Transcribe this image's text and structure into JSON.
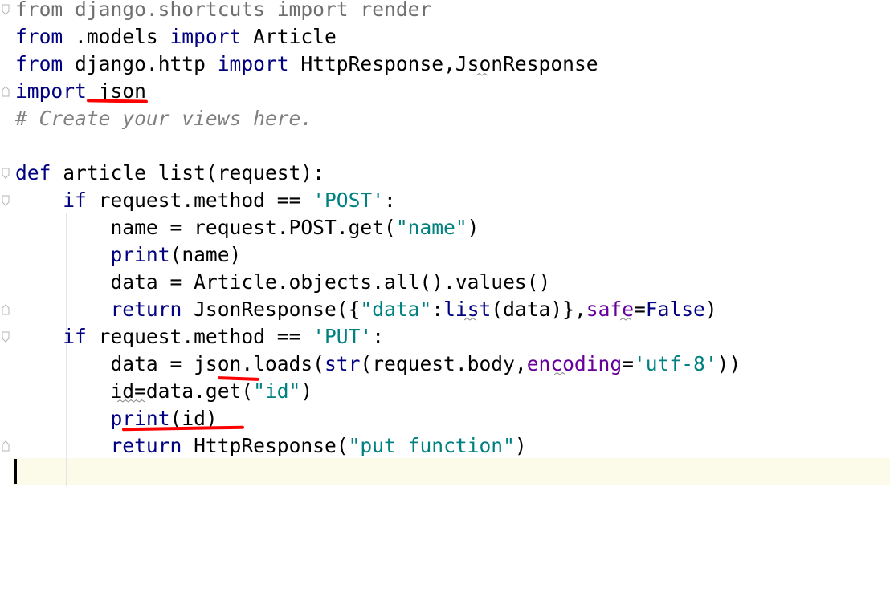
{
  "editor": {
    "language": "python",
    "colors": {
      "keyword": "#000080",
      "string": "#008080",
      "comment": "#808080",
      "param": "#660099",
      "current_line": "#fcfae8",
      "annotation_ink": "#ff0000"
    },
    "lines": [
      {
        "tokens": [
          {
            "t": "from django.shortcuts import render",
            "c": "dim"
          }
        ]
      },
      {
        "tokens": [
          {
            "t": "from",
            "c": "kw"
          },
          {
            "t": " .models ",
            "c": ""
          },
          {
            "t": "import",
            "c": "kw"
          },
          {
            "t": " Article",
            "c": ""
          }
        ]
      },
      {
        "tokens": [
          {
            "t": "from",
            "c": "kw"
          },
          {
            "t": " django.http ",
            "c": ""
          },
          {
            "t": "import",
            "c": "kw"
          },
          {
            "t": " HttpResponse,JsonResponse",
            "c": ""
          }
        ]
      },
      {
        "tokens": [
          {
            "t": "import",
            "c": "kw"
          },
          {
            "t": " json",
            "c": ""
          }
        ]
      },
      {
        "tokens": [
          {
            "t": "# Create your views here.",
            "c": "cm"
          }
        ]
      },
      {
        "tokens": [
          {
            "t": "",
            "c": ""
          }
        ]
      },
      {
        "tokens": [
          {
            "t": "def",
            "c": "kw"
          },
          {
            "t": " article_list(request):",
            "c": ""
          }
        ]
      },
      {
        "tokens": [
          {
            "t": "    ",
            "c": ""
          },
          {
            "t": "if",
            "c": "kw"
          },
          {
            "t": " request.method == ",
            "c": ""
          },
          {
            "t": "'POST'",
            "c": "str"
          },
          {
            "t": ":",
            "c": ""
          }
        ]
      },
      {
        "tokens": [
          {
            "t": "        name = request.POST.get(",
            "c": ""
          },
          {
            "t": "\"name\"",
            "c": "str"
          },
          {
            "t": ")",
            "c": ""
          }
        ]
      },
      {
        "tokens": [
          {
            "t": "        ",
            "c": ""
          },
          {
            "t": "print",
            "c": "bi"
          },
          {
            "t": "(name)",
            "c": ""
          }
        ]
      },
      {
        "tokens": [
          {
            "t": "        data = Article.objects.all().values()",
            "c": ""
          }
        ]
      },
      {
        "tokens": [
          {
            "t": "        ",
            "c": ""
          },
          {
            "t": "return",
            "c": "kw"
          },
          {
            "t": " JsonResponse({",
            "c": ""
          },
          {
            "t": "\"data\"",
            "c": "str"
          },
          {
            "t": ":",
            "c": ""
          },
          {
            "t": "list",
            "c": "bi"
          },
          {
            "t": "(data)},",
            "c": ""
          },
          {
            "t": "safe",
            "c": "par"
          },
          {
            "t": "=",
            "c": ""
          },
          {
            "t": "False",
            "c": "kw"
          },
          {
            "t": ")",
            "c": ""
          }
        ]
      },
      {
        "tokens": [
          {
            "t": "    ",
            "c": ""
          },
          {
            "t": "if",
            "c": "kw"
          },
          {
            "t": " request.method == ",
            "c": ""
          },
          {
            "t": "'PUT'",
            "c": "str"
          },
          {
            "t": ":",
            "c": ""
          }
        ]
      },
      {
        "tokens": [
          {
            "t": "        data = json.loads(",
            "c": ""
          },
          {
            "t": "str",
            "c": "bi"
          },
          {
            "t": "(request.body,",
            "c": ""
          },
          {
            "t": "encoding",
            "c": "par"
          },
          {
            "t": "=",
            "c": ""
          },
          {
            "t": "'utf-8'",
            "c": "str"
          },
          {
            "t": "))",
            "c": ""
          }
        ]
      },
      {
        "tokens": [
          {
            "t": "        id=data.get(",
            "c": ""
          },
          {
            "t": "\"id\"",
            "c": "str"
          },
          {
            "t": ")",
            "c": ""
          }
        ]
      },
      {
        "tokens": [
          {
            "t": "        ",
            "c": ""
          },
          {
            "t": "print",
            "c": "bi"
          },
          {
            "t": "(id)",
            "c": ""
          }
        ]
      },
      {
        "tokens": [
          {
            "t": "        ",
            "c": ""
          },
          {
            "t": "return",
            "c": "kw"
          },
          {
            "t": " HttpResponse(",
            "c": ""
          },
          {
            "t": "\"put function\"",
            "c": "str"
          },
          {
            "t": ")",
            "c": ""
          }
        ]
      },
      {
        "tokens": [
          {
            "t": "",
            "c": ""
          }
        ]
      }
    ],
    "fold_markers": [
      {
        "line": 0,
        "kind": "open"
      },
      {
        "line": 3,
        "kind": "close"
      },
      {
        "line": 6,
        "kind": "open"
      },
      {
        "line": 7,
        "kind": "open"
      },
      {
        "line": 11,
        "kind": "close"
      },
      {
        "line": 12,
        "kind": "open"
      },
      {
        "line": 16,
        "kind": "close"
      }
    ]
  }
}
